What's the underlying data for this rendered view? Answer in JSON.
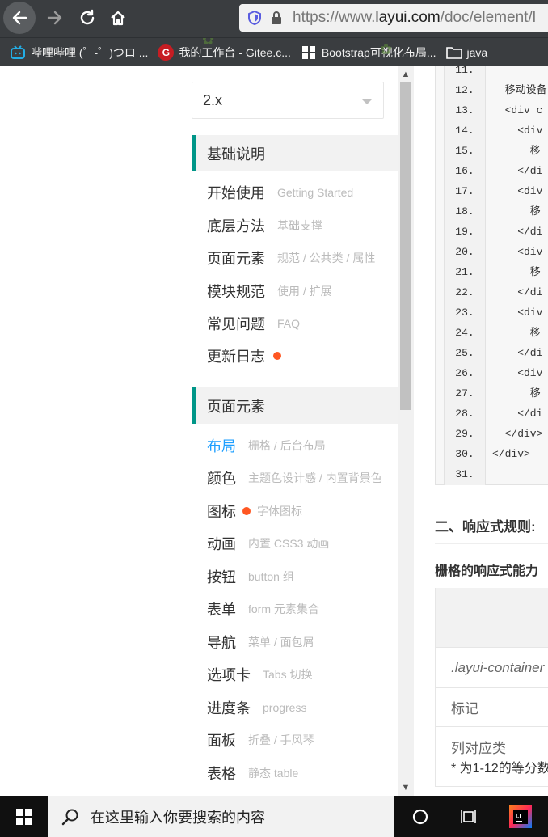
{
  "browser": {
    "url_prefix": "https://www.",
    "url_domain": "layui.com",
    "url_path": "/doc/element/l",
    "bookmarks": [
      {
        "label": "哔哩哔哩 (゜-゜)つロ ...",
        "icon": "bilibili-icon",
        "color": "#23ade5"
      },
      {
        "label": "我的工作台 - Gitee.c...",
        "icon": "gitee-icon",
        "color": "#c71d23"
      },
      {
        "label": "Bootstrap可视化布局...",
        "icon": "grid-icon",
        "color": "#ffffff"
      },
      {
        "label": "java",
        "icon": "folder-icon",
        "color": "#ffffff"
      }
    ]
  },
  "sidebar": {
    "version": "2.x",
    "section1": "基础说明",
    "section1_items": [
      {
        "label": "开始使用",
        "sub": "Getting Started"
      },
      {
        "label": "底层方法",
        "sub": "基础支撑"
      },
      {
        "label": "页面元素",
        "sub": "规范 / 公共类 / 属性"
      },
      {
        "label": "模块规范",
        "sub": "使用 / 扩展"
      },
      {
        "label": "常见问题",
        "sub": "FAQ"
      },
      {
        "label": "更新日志",
        "sub": ""
      }
    ],
    "section2": "页面元素",
    "section2_items": [
      {
        "label": "布局",
        "sub": "栅格 / 后台布局"
      },
      {
        "label": "颜色",
        "sub": "主题色设计感 / 内置背景色"
      },
      {
        "label": "图标",
        "sub": "字体图标"
      },
      {
        "label": "动画",
        "sub": "内置 CSS3 动画"
      },
      {
        "label": "按钮",
        "sub": "button 组"
      },
      {
        "label": "表单",
        "sub": "form 元素集合"
      },
      {
        "label": "导航",
        "sub": "菜单 / 面包屑"
      },
      {
        "label": "选项卡",
        "sub": "Tabs 切换"
      },
      {
        "label": "进度条",
        "sub": "progress"
      },
      {
        "label": "面板",
        "sub": "折叠 / 手风琴"
      },
      {
        "label": "表格",
        "sub": "静态 table"
      }
    ]
  },
  "code": {
    "lines": [
      {
        "n": "11.",
        "t": ""
      },
      {
        "n": "12.",
        "t": "  移动设备"
      },
      {
        "n": "13.",
        "t": "  <div c"
      },
      {
        "n": "14.",
        "t": "    <div"
      },
      {
        "n": "15.",
        "t": "      移"
      },
      {
        "n": "16.",
        "t": "    </di"
      },
      {
        "n": "17.",
        "t": "    <div"
      },
      {
        "n": "18.",
        "t": "      移"
      },
      {
        "n": "19.",
        "t": "    </di"
      },
      {
        "n": "20.",
        "t": "    <div"
      },
      {
        "n": "21.",
        "t": "      移"
      },
      {
        "n": "22.",
        "t": "    </di"
      },
      {
        "n": "23.",
        "t": "    <div"
      },
      {
        "n": "24.",
        "t": "      移"
      },
      {
        "n": "25.",
        "t": "    </di"
      },
      {
        "n": "26.",
        "t": "    <div"
      },
      {
        "n": "27.",
        "t": "      移"
      },
      {
        "n": "28.",
        "t": "    </di"
      },
      {
        "n": "29.",
        "t": "  </div>"
      },
      {
        "n": "30.",
        "t": "</div>"
      },
      {
        "n": "31.",
        "t": ""
      }
    ]
  },
  "content": {
    "heading": "二、响应式规则:",
    "para": "栅格的响应式能力",
    "table_rows": [
      ".layui-container",
      "标记",
      "列对应类",
      "* 为1-12的等分数"
    ]
  },
  "taskbar": {
    "search_placeholder": "在这里输入你要搜索的内容"
  }
}
